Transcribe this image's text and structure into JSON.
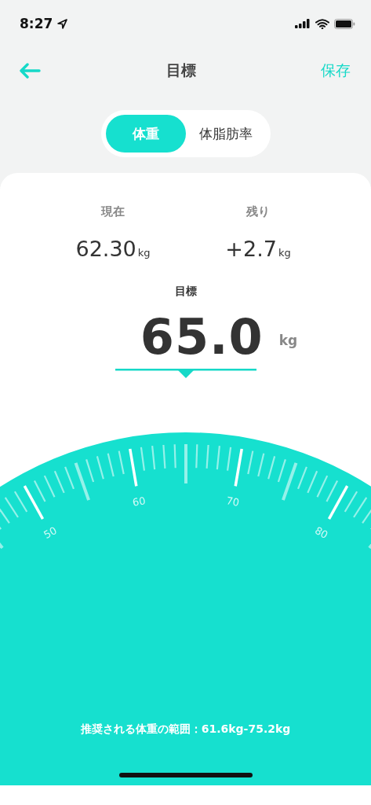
{
  "status_bar": {
    "time": "8:27"
  },
  "nav": {
    "title": "目標",
    "save": "保存"
  },
  "tabs": [
    {
      "label": "体重",
      "selected": true
    },
    {
      "label": "体脂肪率",
      "selected": false
    }
  ],
  "stats": [
    {
      "label": "現在",
      "value": "62.30",
      "unit": "kg"
    },
    {
      "label": "残り",
      "value": "+2.7",
      "unit": "kg"
    }
  ],
  "target": {
    "label": "目標",
    "value": "65.0",
    "unit": "kg"
  },
  "dial": {
    "labels": [
      {
        "value": "50"
      },
      {
        "value": "60"
      },
      {
        "value": "70"
      },
      {
        "value": "80"
      }
    ]
  },
  "range_note": "推奨される体重の範囲：61.6kg-75.2kg"
}
